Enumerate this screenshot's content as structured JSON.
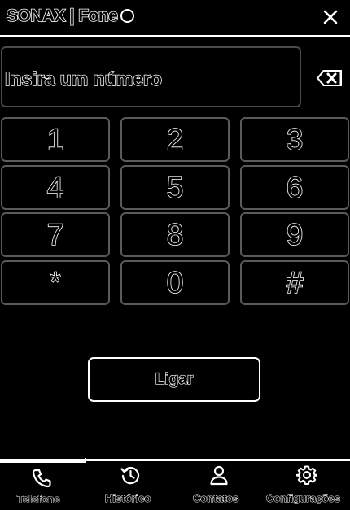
{
  "header": {
    "title": "SONAX | Fone",
    "close_icon": "close-icon",
    "status_icon": "status-circle-icon"
  },
  "dialer": {
    "number_placeholder": "Insira um número",
    "backspace_icon": "backspace-icon",
    "keys": [
      "1",
      "2",
      "3",
      "4",
      "5",
      "6",
      "7",
      "8",
      "9",
      "*",
      "0",
      "#"
    ],
    "call_label": "Ligar"
  },
  "nav": {
    "items": [
      {
        "label": "Telefone",
        "icon": "phone-icon",
        "active": true
      },
      {
        "label": "Histórico",
        "icon": "history-icon",
        "active": false
      },
      {
        "label": "Contatos",
        "icon": "person-icon",
        "active": false
      },
      {
        "label": "Configurações",
        "icon": "gear-icon",
        "active": false
      }
    ]
  },
  "colors": {
    "background": "#000000",
    "foreground": "#ffffff",
    "border_muted": "#5a5a5a"
  }
}
